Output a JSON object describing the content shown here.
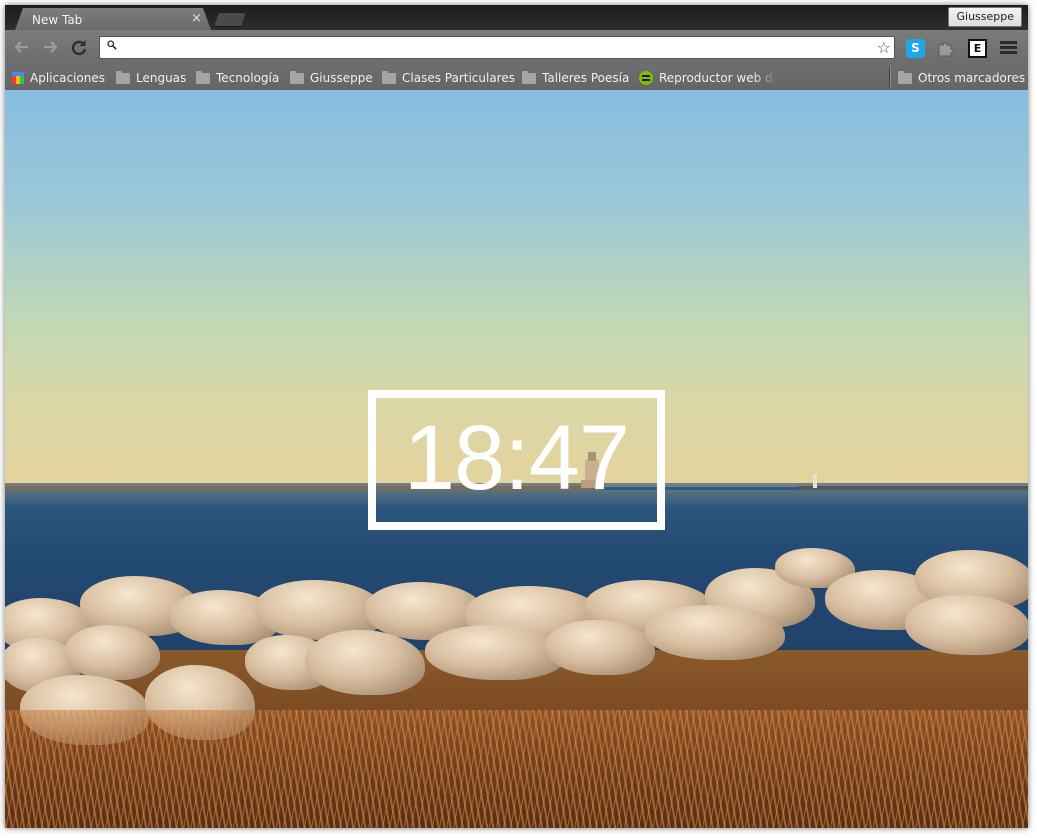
{
  "tab": {
    "title": "New Tab",
    "close_glyph": "×"
  },
  "profile": {
    "name": "Giusseppe"
  },
  "toolbar": {
    "back_icon": "back-arrow-icon",
    "forward_icon": "forward-arrow-icon",
    "reload_icon": "reload-icon",
    "omnibox": {
      "value": "",
      "placeholder": ""
    },
    "star_glyph": "☆",
    "extensions": [
      {
        "name": "skype-icon",
        "glyph": "S",
        "color": "#1da9e8"
      },
      {
        "name": "puzzle-icon"
      },
      {
        "name": "evernote-clipper-icon",
        "glyph": "E"
      }
    ]
  },
  "bookmarks": {
    "items": [
      {
        "label": "Aplicaciones",
        "icon": "apps-icon"
      },
      {
        "label": "Lenguas",
        "icon": "folder-icon"
      },
      {
        "label": "Tecnología",
        "icon": "folder-icon"
      },
      {
        "label": "Giusseppe",
        "icon": "folder-icon"
      },
      {
        "label": "Clases Particulares",
        "icon": "folder-icon"
      },
      {
        "label": "Talleres Poesía",
        "icon": "folder-icon"
      },
      {
        "label": "Reproductor web de S",
        "icon": "spotify-icon"
      }
    ],
    "other": {
      "label": "Otros marcadores",
      "icon": "folder-icon"
    }
  },
  "clock": {
    "time": "18:47"
  },
  "colors": {
    "clock_border": "#ffffff",
    "chrome_toolbar": "#737373",
    "spotify": "#84bd00"
  }
}
